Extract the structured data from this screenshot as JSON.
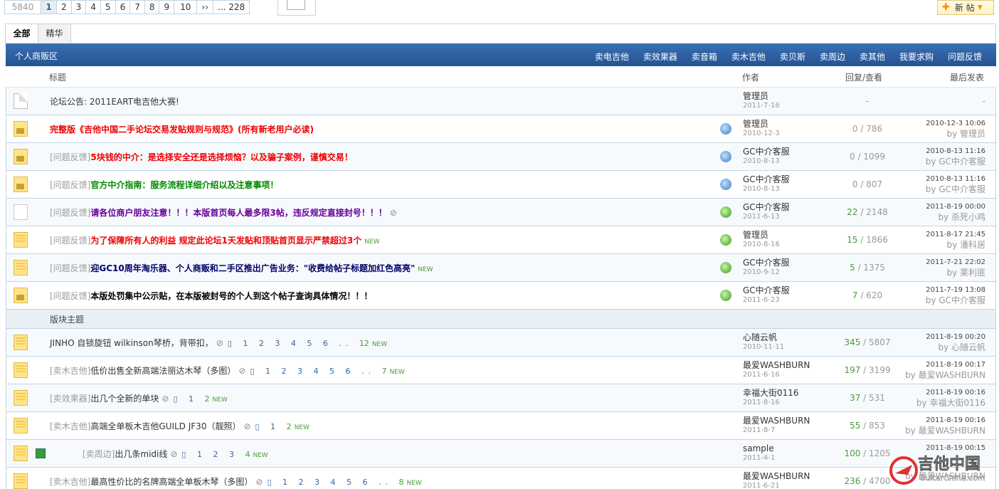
{
  "pager": {
    "total": "5840",
    "pages": [
      "1",
      "2",
      "3",
      "4",
      "5",
      "6",
      "7",
      "8",
      "9",
      "10"
    ],
    "next": "››",
    "last": "... 228"
  },
  "new_post": "新 帖",
  "tabs": [
    "全部",
    "精华"
  ],
  "forum": {
    "title": "个人商贩区",
    "links": [
      "卖电吉他",
      "卖效果器",
      "卖音箱",
      "卖木吉他",
      "卖贝斯",
      "卖周边",
      "卖其他",
      "我要求购",
      "问题反馈"
    ]
  },
  "columns": {
    "title": "标题",
    "author": "作者",
    "replies": "回复/查看",
    "last": "最后发表"
  },
  "announce": {
    "subject": "论坛公告: 2011EART电吉他大赛!",
    "author": "管理员",
    "date": "2011-7-16",
    "rv": "-",
    "last": "-"
  },
  "stickies": [
    {
      "prefix": "",
      "subject": "完整版《吉他中国二手论坛交易发贴规则与规范》(所有新老用户必读)",
      "style": "red",
      "icon": "lock",
      "pin": "b",
      "author": "管理员",
      "date": "2010-12-3",
      "replies": "0",
      "views": "786",
      "last_time": "2010-12-3 10:06",
      "last_by": "by 管理员",
      "new": ""
    },
    {
      "prefix": "[问题反馈]",
      "subject": "5块钱的中介：是选择安全还是选择烦恼？以及骗子案例，谨慎交易！",
      "style": "red",
      "icon": "lock",
      "pin": "b",
      "author": "GC中介客服",
      "date": "2010-8-13",
      "replies": "0",
      "views": "1099",
      "last_time": "2010-8-13 11:16",
      "last_by": "by GC中介客服",
      "new": ""
    },
    {
      "prefix": "[问题反馈]",
      "subject": "官方中介指南：服务流程详细介绍以及注意事项！",
      "style": "grn",
      "icon": "lock",
      "pin": "b",
      "author": "GC中介客服",
      "date": "2010-8-13",
      "replies": "0",
      "views": "807",
      "last_time": "2010-8-13 11:16",
      "last_by": "by GC中介客服",
      "new": ""
    },
    {
      "prefix": "[问题反馈]",
      "subject": "请各位商户朋友注意！！！本版首页每人最多限3帖，违反规定直接封号！！！",
      "style": "pur",
      "icon": "gray",
      "pin": "g",
      "author": "GC中介客服",
      "date": "2011-6-13",
      "replies": "22",
      "views": "2148",
      "last_time": "2011-8-19 00:00",
      "last_by": "by 杀死小鸡",
      "new": "",
      "clip": true
    },
    {
      "prefix": "[问题反馈]",
      "subject": "为了保障所有人的利益 规定此论坛1天发贴和顶贴首页显示严禁超过3个",
      "style": "red",
      "icon": "fold",
      "pin": "g",
      "author": "管理员",
      "date": "2010-8-16",
      "replies": "15",
      "views": "1866",
      "last_time": "2011-8-17 21:45",
      "last_by": "by 潘科居",
      "new": "NEW"
    },
    {
      "prefix": "[问题反馈]",
      "subject": "迎GC10周年淘乐器、个人商贩和二手区推出广告业务：\"收费给帖子标题加红色高亮\"",
      "style": "blu",
      "icon": "fold",
      "pin": "g",
      "author": "GC中介客服",
      "date": "2010-9-12",
      "replies": "5",
      "views": "1375",
      "last_time": "2011-7-21 22:02",
      "last_by": "by 莱利匪",
      "new": "NEW"
    },
    {
      "prefix": "[问题反馈]",
      "subject": "本版处罚集中公示贴，在本版被封号的个人到这个帖子查询具体情况！！！",
      "style": "blk",
      "icon": "lock",
      "pin": "g",
      "author": "GC中介客服",
      "date": "2011-6-23",
      "replies": "7",
      "views": "620",
      "last_time": "2011-7-19 13:08",
      "last_by": "by GC中介客服",
      "new": ""
    }
  ],
  "section": "版块主题",
  "threads": [
    {
      "prefix": "",
      "subject": "JINHO 自锁旋钮 wilkinson琴桥，背带扣，",
      "pages": "1 2 3 4 5 6 ..",
      "lastpage": "12",
      "author": "心随云帆",
      "date": "2010-11-11",
      "replies": "345",
      "views": "5807",
      "last_time": "2011-8-19 00:20",
      "last_by": "by 心随云帆"
    },
    {
      "prefix": "[卖木吉他]",
      "subject": "低价出售全新高端法丽达木琴（多图）",
      "pages": "1 2 3 4 5 6 ..",
      "lastpage": "7",
      "author": "最爱WASHBURN",
      "date": "2011-6-16",
      "replies": "197",
      "views": "3199",
      "last_time": "2011-8-19 00:17",
      "last_by": "by 最爱WASHBURN"
    },
    {
      "prefix": "[卖效果器]",
      "subject": "出几个全新的单块",
      "pages": "1",
      "lastpage": "2",
      "author": "幸福大街0116",
      "date": "2011-8-16",
      "replies": "37",
      "views": "531",
      "last_time": "2011-8-19 00:16",
      "last_by": "by 幸福大街0116"
    },
    {
      "prefix": "[卖木吉他]",
      "subject": "高端全单板木吉他GUILD JF30（靓照）",
      "pages": "1",
      "lastpage": "2",
      "author": "最爱WASHBURN",
      "date": "2011-8-7",
      "replies": "55",
      "views": "853",
      "last_time": "2011-8-19 00:16",
      "last_by": "by 最爱WASHBURN"
    },
    {
      "prefix": "[卖周边]",
      "subject": "出几条midi线",
      "pages": "1 2 3",
      "lastpage": "4",
      "author": "sample",
      "date": "2011-4-1",
      "replies": "100",
      "views": "1205",
      "last_time": "2011-8-19 00:15",
      "last_by": "",
      "mini": true
    },
    {
      "prefix": "[卖木吉他]",
      "subject": "最高性价比的名牌高端全单板木琴（多图）",
      "pages": "1 2 3 4 5 6 ..",
      "lastpage": "8",
      "author": "最爱WASHBURN",
      "date": "2011-6-21",
      "replies": "236",
      "views": "4700",
      "last_time": "",
      "last_by": "by 最爱WASHBURN"
    }
  ],
  "watermark": {
    "cn": "吉他中国",
    "en": "GuitarChina.com"
  }
}
